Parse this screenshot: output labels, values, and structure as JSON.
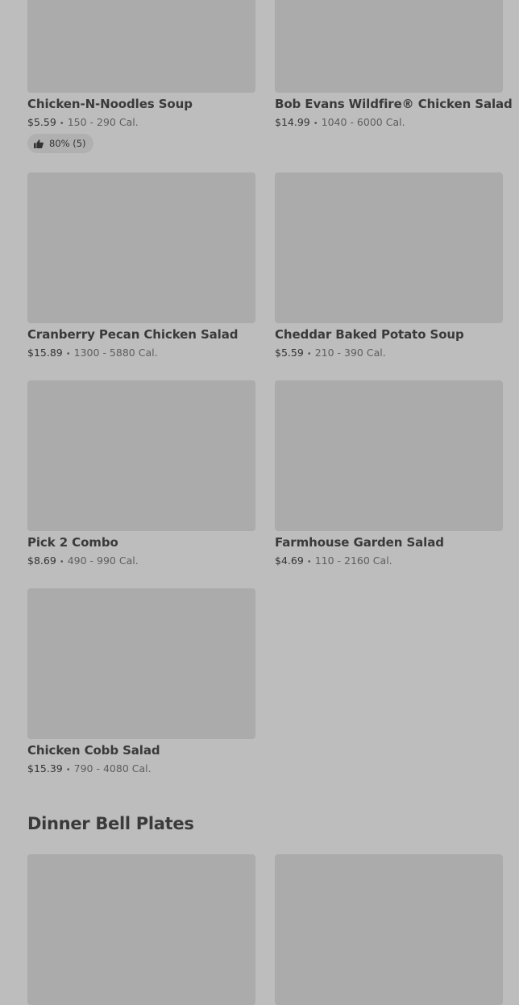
{
  "items": [
    {
      "name": "Chicken-N-Noodles Soup",
      "price": "$5.59",
      "calories": "150 - 290 Cal.",
      "rating": "80% (5)"
    },
    {
      "name": "Bob Evans Wildfire® Chicken Salad",
      "price": "$14.99",
      "calories": "1040 - 6000 Cal."
    },
    {
      "name": "Cranberry Pecan Chicken Salad",
      "price": "$15.89",
      "calories": "1300 - 5880 Cal."
    },
    {
      "name": "Cheddar Baked Potato Soup",
      "price": "$5.59",
      "calories": "210 - 390 Cal."
    },
    {
      "name": "Pick 2 Combo",
      "price": "$8.69",
      "calories": "490 - 990 Cal."
    },
    {
      "name": "Farmhouse Garden Salad",
      "price": "$4.69",
      "calories": "110 - 2160 Cal."
    },
    {
      "name": "Chicken Cobb Salad",
      "price": "$15.39",
      "calories": "790 - 4080 Cal."
    }
  ],
  "separator": "•",
  "next_section": {
    "title": "Dinner Bell Plates"
  },
  "colors": {
    "overlay_background": "#bdbdbd",
    "image_placeholder": "#ababab",
    "rating_chip": "#b0b0b0"
  },
  "icons": {
    "rating": "thumbs-up-icon"
  }
}
